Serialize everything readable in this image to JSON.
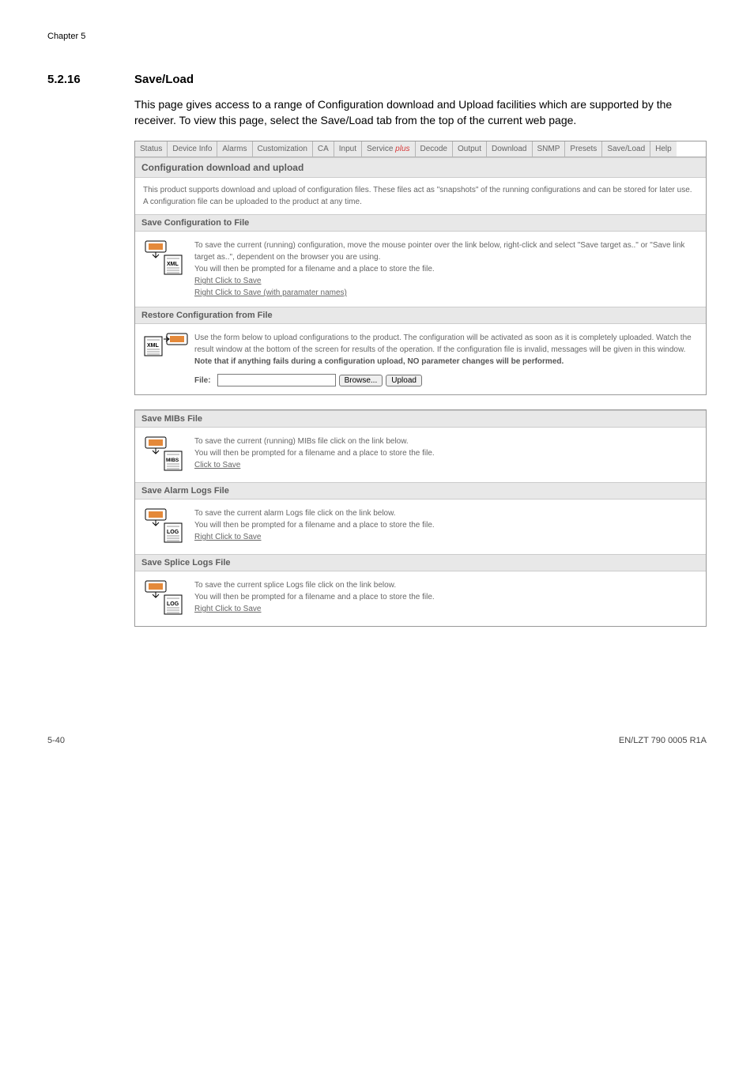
{
  "chapter_label": "Chapter 5",
  "heading_number": "5.2.16",
  "heading_title": "Save/Load",
  "intro_para": "This page gives access to a range of Configuration download and Upload facilities which are supported by the receiver. To view this page, select the Save/Load tab from the top of the current web page.",
  "tabs": [
    "Status",
    "Device Info",
    "Alarms",
    "Customization",
    "CA",
    "Input",
    "Service ",
    "Decode",
    "Output",
    "Download",
    "SNMP",
    "Presets",
    "Save/Load",
    "Help"
  ],
  "service_plus": "plus",
  "panel1": {
    "title": "Configuration download and upload",
    "intro": "This product supports download and upload of configuration files. These files act as \"snapshots\" of the running configurations and can be stored for later use. A configuration file can be uploaded to the product at any time.",
    "save_title": "Save Configuration to File",
    "save_line1": "To save the current (running) configuration, move the mouse pointer over the link below, right-click and select \"Save target as..\" or \"Save link target as..\", dependent on the browser you are using.",
    "save_line2": "You will then be prompted for a filename and a place to store the file.",
    "save_link1": "Right Click to Save",
    "save_link2": "Right Click to Save (with paramater names)",
    "xml_label": "XML",
    "restore_title": "Restore Configuration from File",
    "restore_line1": "Use the form below to upload configurations to the product. The configuration will be activated as soon as it is completely uploaded. Watch the result window at the bottom of the screen for results of the operation. If the configuration file is invalid, messages will be given in this window.",
    "restore_bold": "Note that if anything fails during a configuration upload, NO parameter changes will be performed.",
    "file_label": "File:",
    "browse_btn": "Browse...",
    "upload_btn": "Upload"
  },
  "panel2": {
    "mibs_title": "Save MIBs File",
    "mibs_line1": "To save the current (running) MIBs file click on the link below.",
    "mibs_line2": "You will then be prompted for a filename and a place to store the file.",
    "mibs_link": "Click to Save",
    "mibs_label": "MIBS",
    "alarm_title": "Save Alarm Logs File",
    "alarm_line1": "To save the current alarm Logs file click on the link below.",
    "alarm_line2": "You will then be prompted for a filename and a place to store the file.",
    "alarm_link": "Right Click to Save",
    "log_label": "LOG",
    "splice_title": "Save Splice Logs File",
    "splice_line1": "To save the current splice Logs file click on the link below.",
    "splice_line2": "You will then be prompted for a filename and a place to store the file.",
    "splice_link": "Right Click to Save"
  },
  "footer_left": "5-40",
  "footer_right": "EN/LZT 790 0005 R1A"
}
